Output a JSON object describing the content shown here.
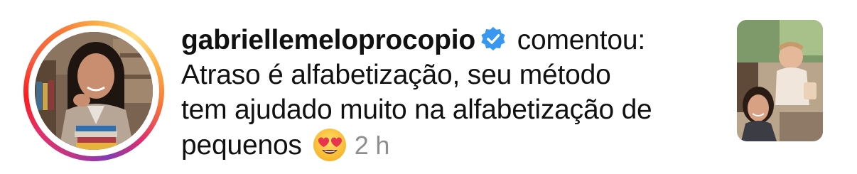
{
  "notification": {
    "username": "gabriellemeloprocopio",
    "verified_icon": "verified-badge-icon",
    "action_text": "comentou:",
    "comment_lines": [
      "Atraso é alfabetização, seu método",
      "tem ajudado muito na alfabetização de",
      "pequenos"
    ],
    "emoji": "heart-eyes-emoji",
    "timestamp": "2 h"
  },
  "colors": {
    "text": "#111111",
    "timestamp": "#8e8e8e",
    "verified_badge": "#3897f0",
    "story_ring": [
      "#833ab4",
      "#c13584",
      "#e1306c",
      "#fd1d1d",
      "#f77737",
      "#fcaf45"
    ]
  }
}
